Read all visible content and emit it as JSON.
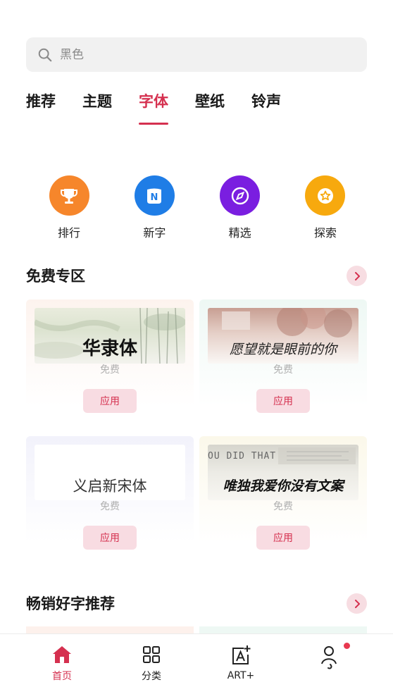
{
  "search": {
    "placeholder": "黑色"
  },
  "tabs": [
    {
      "label": "推荐"
    },
    {
      "label": "主题"
    },
    {
      "label": "字体"
    },
    {
      "label": "壁纸"
    },
    {
      "label": "铃声"
    }
  ],
  "active_tab": "字体",
  "quick_entries": [
    {
      "label": "排行",
      "icon": "trophy-icon",
      "color": "#f6862b"
    },
    {
      "label": "新字",
      "icon": "new-n-icon",
      "color": "#1f7de6"
    },
    {
      "label": "精选",
      "icon": "compass-icon",
      "color": "#7a1ee0"
    },
    {
      "label": "探索",
      "icon": "star-badge-icon",
      "color": "#f7a90e"
    }
  ],
  "free_section": {
    "title": "免费专区",
    "cards": [
      {
        "font_name": "华隶体",
        "price": "免费",
        "apply_label": "应用"
      },
      {
        "font_name": "愿望就是眼前的你",
        "price": "免费",
        "apply_label": "应用"
      },
      {
        "font_name": "义启新宋体",
        "price": "免费",
        "apply_label": "应用"
      },
      {
        "font_name": "唯独我爱你没有文案",
        "price": "免费",
        "apply_label": "应用",
        "background_text": "OU DID THAT"
      }
    ]
  },
  "bestseller_section": {
    "title": "畅销好字推荐"
  },
  "bottom_nav": [
    {
      "label": "首页",
      "icon": "home-icon",
      "active": true
    },
    {
      "label": "分类",
      "icon": "grid-icon"
    },
    {
      "label": "ART+",
      "icon": "art-plus-icon"
    },
    {
      "label": "",
      "icon": "profile-icon",
      "has_notification": true
    }
  ],
  "colors": {
    "accent": "#d5304f",
    "apply_bg": "#f8dce2",
    "search_bg": "#f1f1f1"
  }
}
